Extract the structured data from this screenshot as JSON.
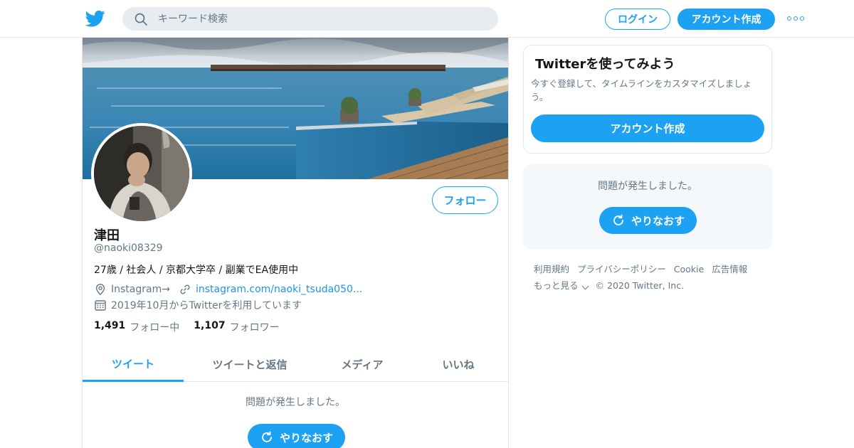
{
  "header": {
    "search_placeholder": "キーワード検索",
    "login_label": "ログイン",
    "signup_label": "アカウント作成"
  },
  "profile": {
    "name": "津田",
    "handle": "@naoki08329",
    "bio": "27歳 / 社会人 / 京都大学卒 / 副業でEA使用中",
    "location": "Instagram→",
    "website": "instagram.com/naoki_tsuda050...",
    "joined": "2019年10月からTwitterを利用しています",
    "follow_label": "フォロー",
    "following_count": "1,491",
    "following_label": "フォロー中",
    "followers_count": "1,107",
    "followers_label": "フォロワー"
  },
  "tabs": [
    {
      "label": "ツイート",
      "active": true
    },
    {
      "label": "ツイートと返信",
      "active": false
    },
    {
      "label": "メディア",
      "active": false
    },
    {
      "label": "いいね",
      "active": false
    }
  ],
  "timeline": {
    "error_message": "問題が発生しました。",
    "retry_label": "やりなおす"
  },
  "sidebar": {
    "signup_title": "Twitterを使ってみよう",
    "signup_desc": "今すぐ登録して、タイムラインをカスタマイズしましょう。",
    "signup_cta": "アカウント作成",
    "error_message": "問題が発生しました。",
    "retry_label": "やりなおす"
  },
  "footer": {
    "links": [
      "利用規約",
      "プライバシーポリシー",
      "Cookie",
      "広告情報"
    ],
    "more_label": "もっと見る",
    "copyright": "© 2020 Twitter, Inc."
  },
  "colors": {
    "accent": "#1da1f2",
    "text_primary": "#14171a",
    "text_secondary": "#657786",
    "border": "#e1e8ed"
  }
}
